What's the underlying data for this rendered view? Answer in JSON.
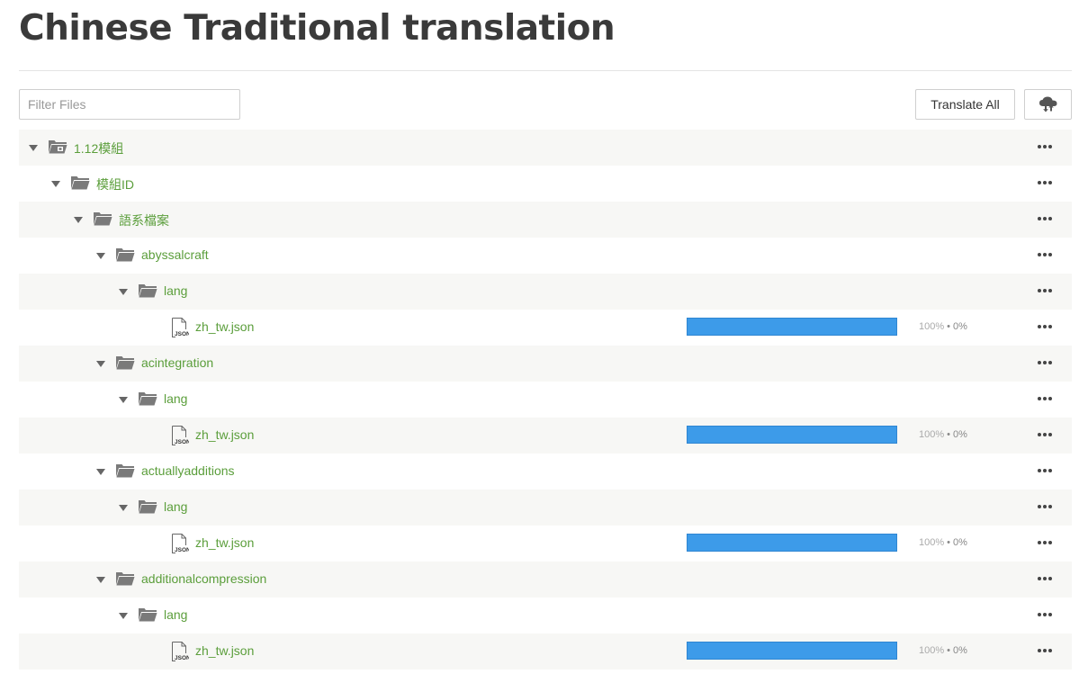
{
  "page": {
    "title": "Chinese Traditional translation"
  },
  "toolbar": {
    "filter_placeholder": "Filter Files",
    "translate_all_label": "Translate All",
    "cloud_icon": "cloud-download-icon"
  },
  "tree": [
    {
      "name": "1.12模組",
      "type": "project-folder",
      "depth": 0
    },
    {
      "name": "模組ID",
      "type": "folder",
      "depth": 1
    },
    {
      "name": "語系檔案",
      "type": "folder",
      "depth": 2
    },
    {
      "name": "abyssalcraft",
      "type": "folder",
      "depth": 3
    },
    {
      "name": "lang",
      "type": "folder",
      "depth": 4
    },
    {
      "name": "zh_tw.json",
      "type": "file",
      "depth": 5,
      "progress": 1.0,
      "translated": "100%",
      "approved": "0%"
    },
    {
      "name": "acintegration",
      "type": "folder",
      "depth": 3
    },
    {
      "name": "lang",
      "type": "folder",
      "depth": 4
    },
    {
      "name": "zh_tw.json",
      "type": "file",
      "depth": 5,
      "progress": 1.0,
      "translated": "100%",
      "approved": "0%"
    },
    {
      "name": "actuallyadditions",
      "type": "folder",
      "depth": 3
    },
    {
      "name": "lang",
      "type": "folder",
      "depth": 4
    },
    {
      "name": "zh_tw.json",
      "type": "file",
      "depth": 5,
      "progress": 1.0,
      "translated": "100%",
      "approved": "0%"
    },
    {
      "name": "additionalcompression",
      "type": "folder",
      "depth": 3
    },
    {
      "name": "lang",
      "type": "folder",
      "depth": 4
    },
    {
      "name": "zh_tw.json",
      "type": "file",
      "depth": 5,
      "progress": 1.0,
      "translated": "100%",
      "approved": "0%"
    }
  ],
  "stats_separator": "•",
  "colors": {
    "link": "#5b9e3b",
    "progress": "#3d9be9",
    "icon": "#7a7a7a"
  }
}
